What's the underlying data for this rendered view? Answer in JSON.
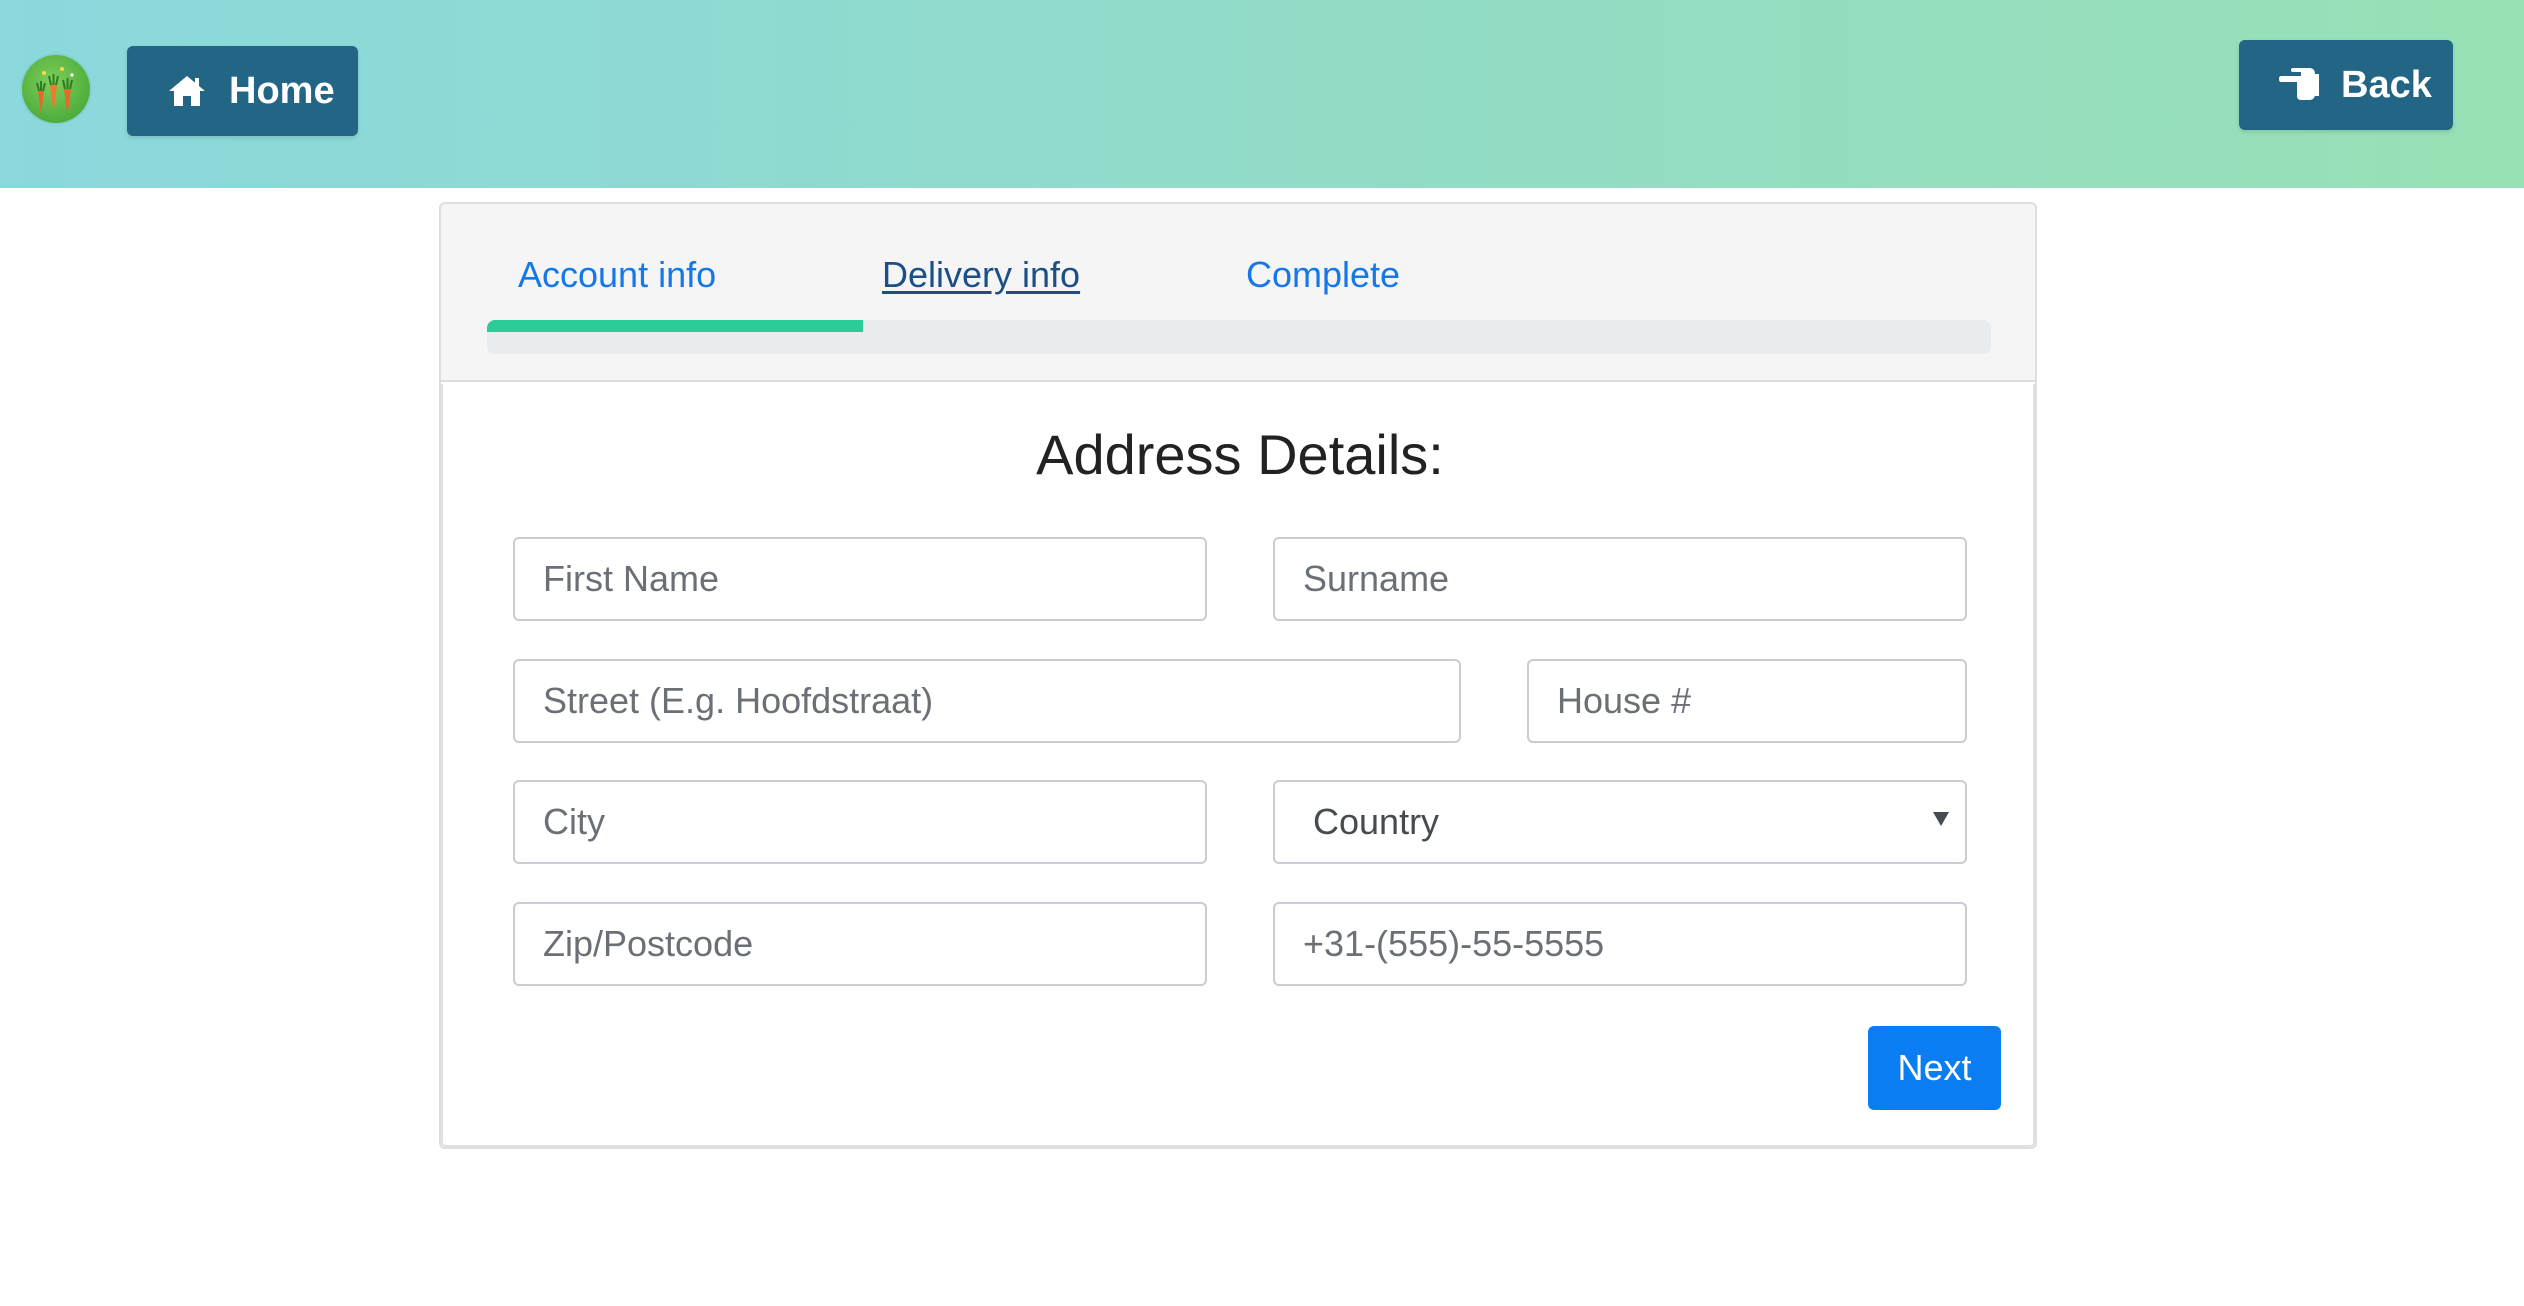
{
  "header": {
    "home_label": "Home",
    "back_label": "Back",
    "logo_icon": "carrots-logo",
    "home_icon": "home-icon",
    "back_icon": "pointing-hand-icon",
    "button_color": "#236584"
  },
  "wizard": {
    "tabs": [
      {
        "label": "Account info",
        "state": "done"
      },
      {
        "label": "Delivery info",
        "state": "active"
      },
      {
        "label": "Complete",
        "state": "pending"
      }
    ],
    "progress_fraction": 0.25,
    "progress_color": "#2ccc98"
  },
  "form": {
    "title": "Address Details:",
    "fields": {
      "first_name": {
        "placeholder": "First Name"
      },
      "surname": {
        "placeholder": "Surname"
      },
      "street": {
        "placeholder": "Street (E.g. Hoofdstraat)"
      },
      "house_number": {
        "placeholder": "House #"
      },
      "city": {
        "placeholder": "City"
      },
      "country": {
        "selected": "Country"
      },
      "zip": {
        "placeholder": "Zip/Postcode"
      },
      "phone": {
        "placeholder": "+31-(555)-55-5555"
      }
    },
    "next_label": "Next",
    "next_color": "#0b7df3"
  }
}
